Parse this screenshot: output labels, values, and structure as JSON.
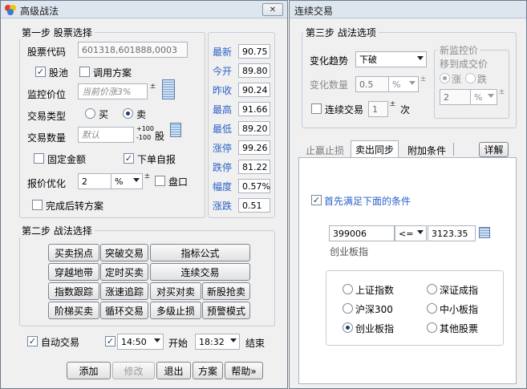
{
  "left_window": {
    "title": "高级战法",
    "close_label": "关闭",
    "step1": {
      "group_title": "第一步 股票选择",
      "stock_code_label": "股票代码",
      "stock_code_value": "601318,601888,0003",
      "check_stock_pool": "股池",
      "check_use_plan": "调用方案",
      "monitor_price_label": "监控价位",
      "monitor_price_placeholder": "当前价涨3%",
      "trade_type_label": "交易类型",
      "radio_buy": "买",
      "radio_sell": "卖",
      "trade_qty_label": "交易数量",
      "trade_qty_placeholder": "默认",
      "qty_step_up": "+100",
      "qty_step_down": "-100",
      "qty_unit": "股",
      "check_fixed_amount": "固定金额",
      "check_self_report": "下单自报",
      "quote_opt_label": "报价优化",
      "quote_opt_value": "2",
      "quote_opt_unit": "%",
      "check_pankou": "盘口",
      "check_finish_switch": "完成后转方案"
    },
    "prices": [
      {
        "label": "最新",
        "value": "90.75"
      },
      {
        "label": "今开",
        "value": "89.80"
      },
      {
        "label": "昨收",
        "value": "90.24"
      },
      {
        "label": "最高",
        "value": "91.66"
      },
      {
        "label": "最低",
        "value": "89.20"
      },
      {
        "label": "涨停",
        "value": "99.26"
      },
      {
        "label": "跌停",
        "value": "81.22"
      },
      {
        "label": "幅度",
        "value": "0.57%"
      },
      {
        "label": "涨跌",
        "value": "0.51"
      }
    ],
    "step2": {
      "group_title": "第二步 战法选择",
      "buttons": [
        "买卖拐点",
        "突破交易",
        "指标公式",
        "穿越地带",
        "定时买卖",
        "连续交易",
        "指数跟踪",
        "涨速追踪",
        "对买对卖",
        "新股抢卖",
        "阶梯买卖",
        "循环交易",
        "多级止损",
        "预警模式"
      ]
    },
    "bottom": {
      "check_auto_trade": "自动交易",
      "start_time": "14:50",
      "start_label": "开始",
      "end_time": "18:32",
      "end_label": "结束",
      "btn_add": "添加",
      "btn_modify": "修改",
      "btn_exit": "退出",
      "btn_plan": "方案",
      "btn_help": "帮助»"
    }
  },
  "right_window": {
    "title": "连续交易",
    "step3": {
      "group_title": "第三步 战法选项",
      "trend_label": "变化趋势",
      "trend_value": "下破",
      "change_qty_label": "变化数量",
      "change_qty_value": "0.5",
      "change_qty_unit": "%",
      "check_continuous": "连续交易",
      "continuous_count": "1",
      "continuous_unit": "次",
      "new_monitor_label": "新监控价",
      "new_monitor_sub": "移到成交价",
      "radio_up": "涨",
      "radio_down": "跌",
      "new_monitor_value": "2",
      "new_monitor_unit": "%"
    },
    "tabs": [
      "止赢止损",
      "卖出同步",
      "附加条件"
    ],
    "active_tab": "卖出同步",
    "detail_button": "详解",
    "condition": {
      "check_first": "首先满足下面的条件",
      "index_code": "399006",
      "operator": "<=",
      "threshold": "3123.35",
      "index_name": "创业板指",
      "index_options": [
        "上证指数",
        "深证成指",
        "沪深300",
        "中小板指",
        "创业板指",
        "其他股票"
      ],
      "selected_index": "创业板指"
    }
  },
  "colors": {
    "price_label": "#2a62c8",
    "check_label": "#2a62c8",
    "title_bar": "#dde5ee"
  }
}
